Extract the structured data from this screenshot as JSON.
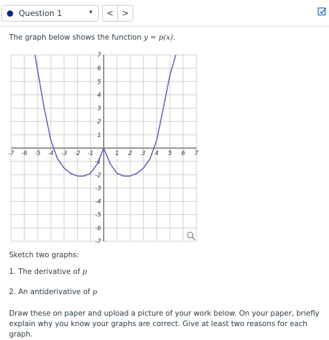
{
  "header": {
    "question_label": "Question 1",
    "dropdown_caret": "▾",
    "prev_symbol": "<",
    "next_symbol": ">",
    "status_icon": "checkbox-check-icon"
  },
  "content": {
    "intro_text": "The graph below shows the function",
    "intro_math": "y = p(x).",
    "sketch_prompt": "Sketch two graphs:",
    "item1_text": "1. The derivative of",
    "item1_math": "p",
    "item2_text": "2. An antiderivative of",
    "item2_math": "p",
    "instructions": "Draw these on paper and upload a picture of your work below. On your paper, briefly explain why you know your graphs are correct. Give at least two reasons for each graph."
  },
  "chart_data": {
    "type": "line",
    "title": "",
    "xlabel": "",
    "ylabel": "",
    "xlim": [
      -7,
      7
    ],
    "ylim": [
      -7,
      7
    ],
    "x_ticks": [
      -7,
      -6,
      -5,
      -4,
      -3,
      -2,
      -1,
      1,
      2,
      3,
      4,
      5,
      6,
      7
    ],
    "y_ticks": [
      -7,
      -6,
      -5,
      -4,
      -3,
      -2,
      -1,
      1,
      2,
      3,
      4,
      5,
      6,
      7
    ],
    "grid": true,
    "line_color": "#5b5bb8",
    "series": [
      {
        "x": [
          -5.2,
          -4.5,
          -4,
          -3.5,
          -3,
          -2.5,
          -2,
          -1.5,
          -1,
          -0.5,
          0,
          0.5,
          1,
          1.5,
          2,
          2.5,
          3,
          3.5,
          4,
          4.5,
          5,
          5.5,
          5.9
        ],
        "y": [
          7.0,
          3.0,
          0.6,
          -0.8,
          -1.5,
          -1.9,
          -2.1,
          -2.1,
          -1.9,
          -1.2,
          0.0,
          -1.2,
          -1.9,
          -2.1,
          -2.1,
          -1.9,
          -1.5,
          -0.8,
          0.6,
          3.0,
          5.5,
          7.2,
          8.0
        ]
      }
    ]
  }
}
